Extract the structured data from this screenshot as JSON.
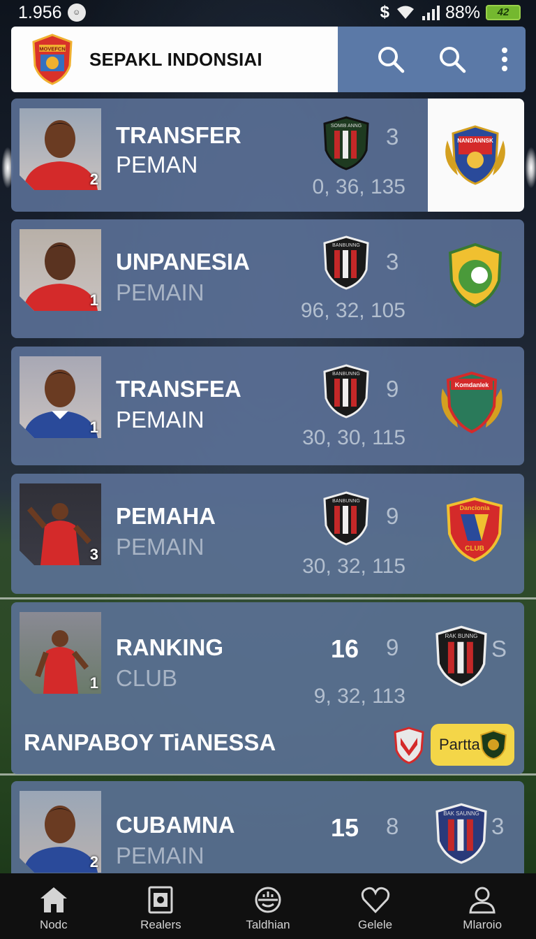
{
  "status_bar": {
    "time": "1.956",
    "battery_pct": "88%",
    "battery_level": "42"
  },
  "app_bar": {
    "title": "SEPAKL INDONSIAI",
    "logo_text": "MOVEFCN"
  },
  "rows": [
    {
      "line1": "TRANSFER",
      "line2": "PEMAN",
      "photo_num": "2",
      "count": "3",
      "stats": "0, 36, 135",
      "badge_text": "SOMIB ANNG",
      "club_text": "NANDANNSK"
    },
    {
      "line1": "UNPANESIA",
      "line2": "PEMAIN",
      "photo_num": "1",
      "count": "3",
      "stats": "96, 32, 105",
      "badge_text": "BANBUNNG",
      "club_text": ""
    },
    {
      "line1": "TRANSFEA",
      "line2": "PEMAIN",
      "photo_num": "1",
      "count": "9",
      "stats": "30, 30, 115",
      "badge_text": "BANBUNNG",
      "club_text": "Komdanlek"
    },
    {
      "line1": "PEMAHA",
      "line2": "PEMAIN",
      "photo_num": "3",
      "count": "9",
      "stats": "30, 32, 115",
      "badge_text": "BANBUNNG",
      "club_text": "Dancionia",
      "club_sub": "CLUB"
    },
    {
      "line1": "RANKING",
      "line2": "CLUB",
      "photo_num": "1",
      "big": "16",
      "count": "9",
      "stats": "9, 32, 113",
      "badge_text": "RAK BUNNG",
      "trailing": "S",
      "promo": "RANPABOY TiANESSA",
      "partner": "Partta"
    },
    {
      "line1": "CUBAMNA",
      "line2": "PEMAIN",
      "photo_num": "2",
      "big": "15",
      "count": "8",
      "badge_text": "BAK SAUNNG",
      "trailing": "3",
      "stats": ""
    }
  ],
  "nav": [
    {
      "label": "Nodc",
      "icon": "home-icon"
    },
    {
      "label": "Realers",
      "icon": "reader-icon"
    },
    {
      "label": "Taldhian",
      "icon": "ball-icon"
    },
    {
      "label": "Gelele",
      "icon": "heart-icon"
    },
    {
      "label": "Mlaroio",
      "icon": "profile-icon"
    }
  ],
  "colors": {
    "card": "#5c7298",
    "appbar_actions": "#5b79a7",
    "partner": "#f4d648",
    "jersey_red": "#d42a2a",
    "jersey_blue": "#2a4a9a"
  }
}
